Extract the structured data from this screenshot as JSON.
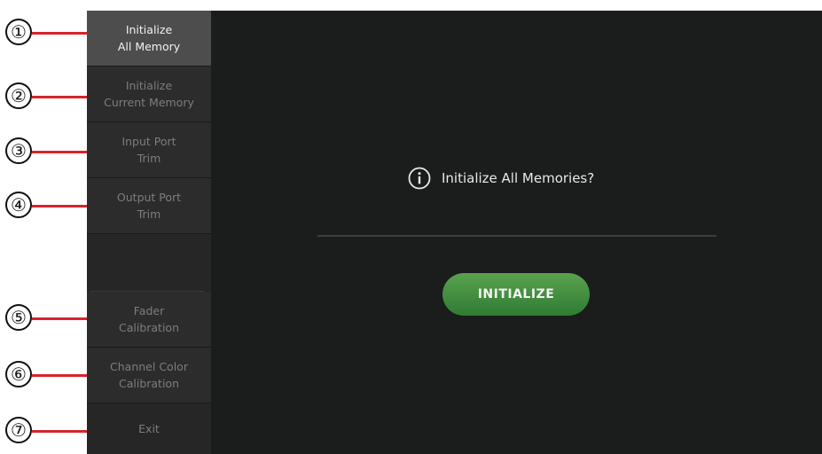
{
  "callouts": [
    "①",
    "②",
    "③",
    "④",
    "⑤",
    "⑥",
    "⑦"
  ],
  "sidebar": {
    "items": [
      {
        "label": "Initialize\nAll Memory",
        "active": true
      },
      {
        "label": "Initialize\nCurrent Memory",
        "active": false
      },
      {
        "label": "Input Port\nTrim",
        "active": false
      },
      {
        "label": "Output Port\nTrim",
        "active": false
      },
      {
        "label": "Fader\nCalibration",
        "active": false
      },
      {
        "label": "Channel Color\nCalibration",
        "active": false
      },
      {
        "label": "Exit",
        "active": false
      }
    ]
  },
  "main": {
    "message_icon": "info-icon",
    "message": "Initialize All Memories?",
    "button_label": "INITIALIZE"
  },
  "colors": {
    "callout_line": "#d8242b",
    "button_green": "#3f8e3c",
    "panel_bg": "#1b1c1c",
    "sidebar_active": "#4d4d4d"
  }
}
